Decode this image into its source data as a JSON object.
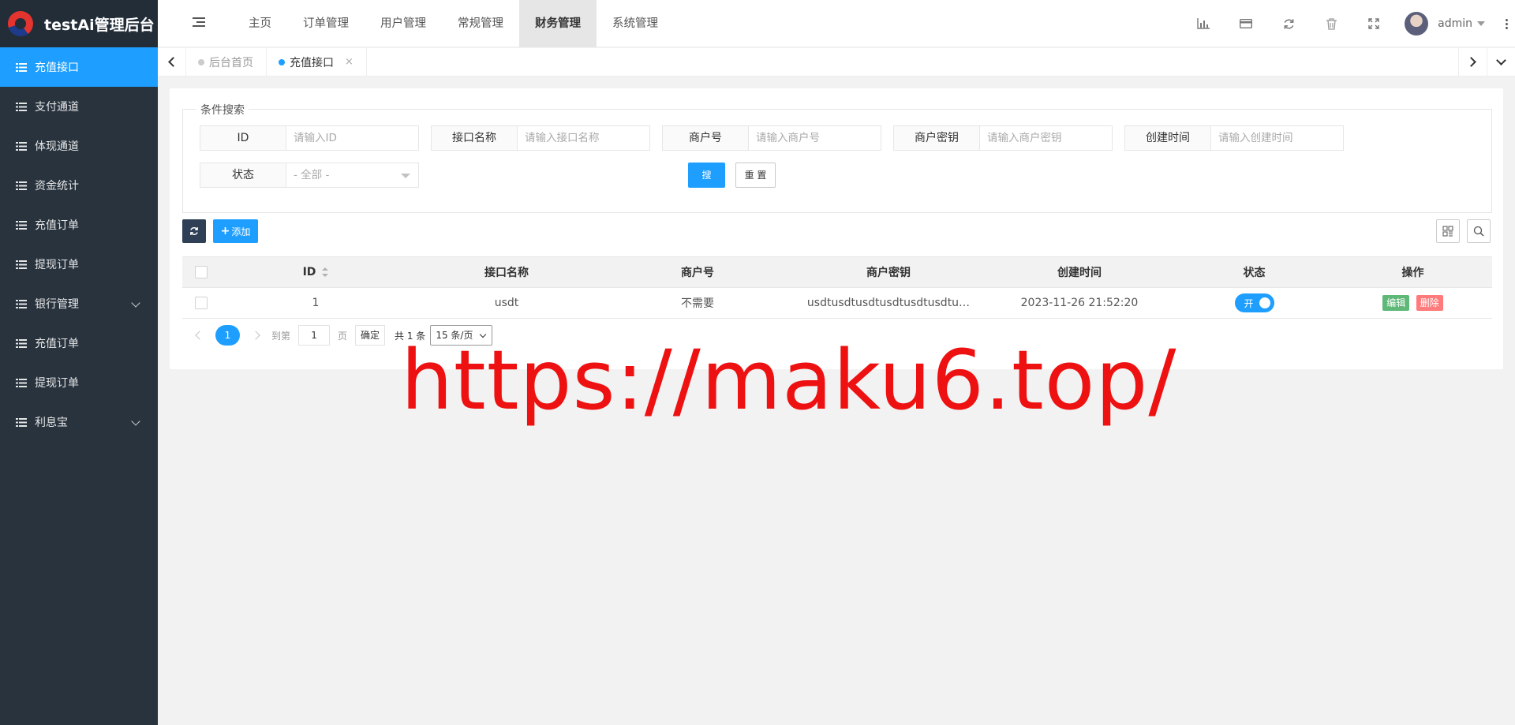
{
  "app": {
    "title": "testAi管理后台"
  },
  "sidebar": {
    "items": [
      {
        "label": "充值接口",
        "active": true,
        "has_children": false
      },
      {
        "label": "支付通道",
        "active": false,
        "has_children": false
      },
      {
        "label": "体现通道",
        "active": false,
        "has_children": false
      },
      {
        "label": "资金统计",
        "active": false,
        "has_children": false
      },
      {
        "label": "充值订单",
        "active": false,
        "has_children": false
      },
      {
        "label": "提现订单",
        "active": false,
        "has_children": false
      },
      {
        "label": "银行管理",
        "active": false,
        "has_children": true
      },
      {
        "label": "充值订单",
        "active": false,
        "has_children": false
      },
      {
        "label": "提现订单",
        "active": false,
        "has_children": false
      },
      {
        "label": "利息宝",
        "active": false,
        "has_children": true
      }
    ]
  },
  "header": {
    "nav": [
      {
        "label": "主页",
        "active": false
      },
      {
        "label": "订单管理",
        "active": false
      },
      {
        "label": "用户管理",
        "active": false
      },
      {
        "label": "常规管理",
        "active": false
      },
      {
        "label": "财务管理",
        "active": true
      },
      {
        "label": "系统管理",
        "active": false
      }
    ],
    "tools": [
      "chart-icon",
      "card-icon",
      "refresh-icon",
      "trash-icon",
      "fullscreen-icon"
    ],
    "user": {
      "name": "admin"
    }
  },
  "tabs": [
    {
      "label": "后台首页",
      "active": false,
      "closable": false
    },
    {
      "label": "充值接口",
      "active": true,
      "closable": true,
      "close_label": "×"
    }
  ],
  "search": {
    "legend": "条件搜索",
    "fields": [
      {
        "label": "ID",
        "placeholder": "请输入ID"
      },
      {
        "label": "接口名称",
        "placeholder": "请输入接口名称"
      },
      {
        "label": "商户号",
        "placeholder": "请输入商户号"
      },
      {
        "label": "商户密钥",
        "placeholder": "请输入商户密钥"
      },
      {
        "label": "创建时间",
        "placeholder": "请输入创建时间"
      }
    ],
    "status": {
      "label": "状态",
      "selected": "- 全部 -"
    },
    "search_button": "搜 索",
    "reset_button": "重 置"
  },
  "toolbar": {
    "add_label": "添加",
    "add_icon": "+"
  },
  "table": {
    "columns": [
      "ID",
      "接口名称",
      "商户号",
      "商户密钥",
      "创建时间",
      "状态",
      "操作"
    ],
    "rows": [
      {
        "id": "1",
        "name": "usdt",
        "merchant_no": "不需要",
        "merchant_key": "usdtusdtusdtusdtusdtusdtu…",
        "created": "2023-11-26 21:52:20",
        "status": "开",
        "edit": "编辑",
        "delete": "删除"
      }
    ]
  },
  "pager": {
    "current": "1",
    "goto_label": "到第",
    "page_value": "1",
    "page_label": "页",
    "confirm": "确定",
    "total": "共 1 条",
    "page_size": "15 条/页"
  },
  "watermark": "https://maku6.top/",
  "colors": {
    "primary": "#1e9fff",
    "sidebar": "#28333e",
    "watermark": "#ee1111"
  }
}
